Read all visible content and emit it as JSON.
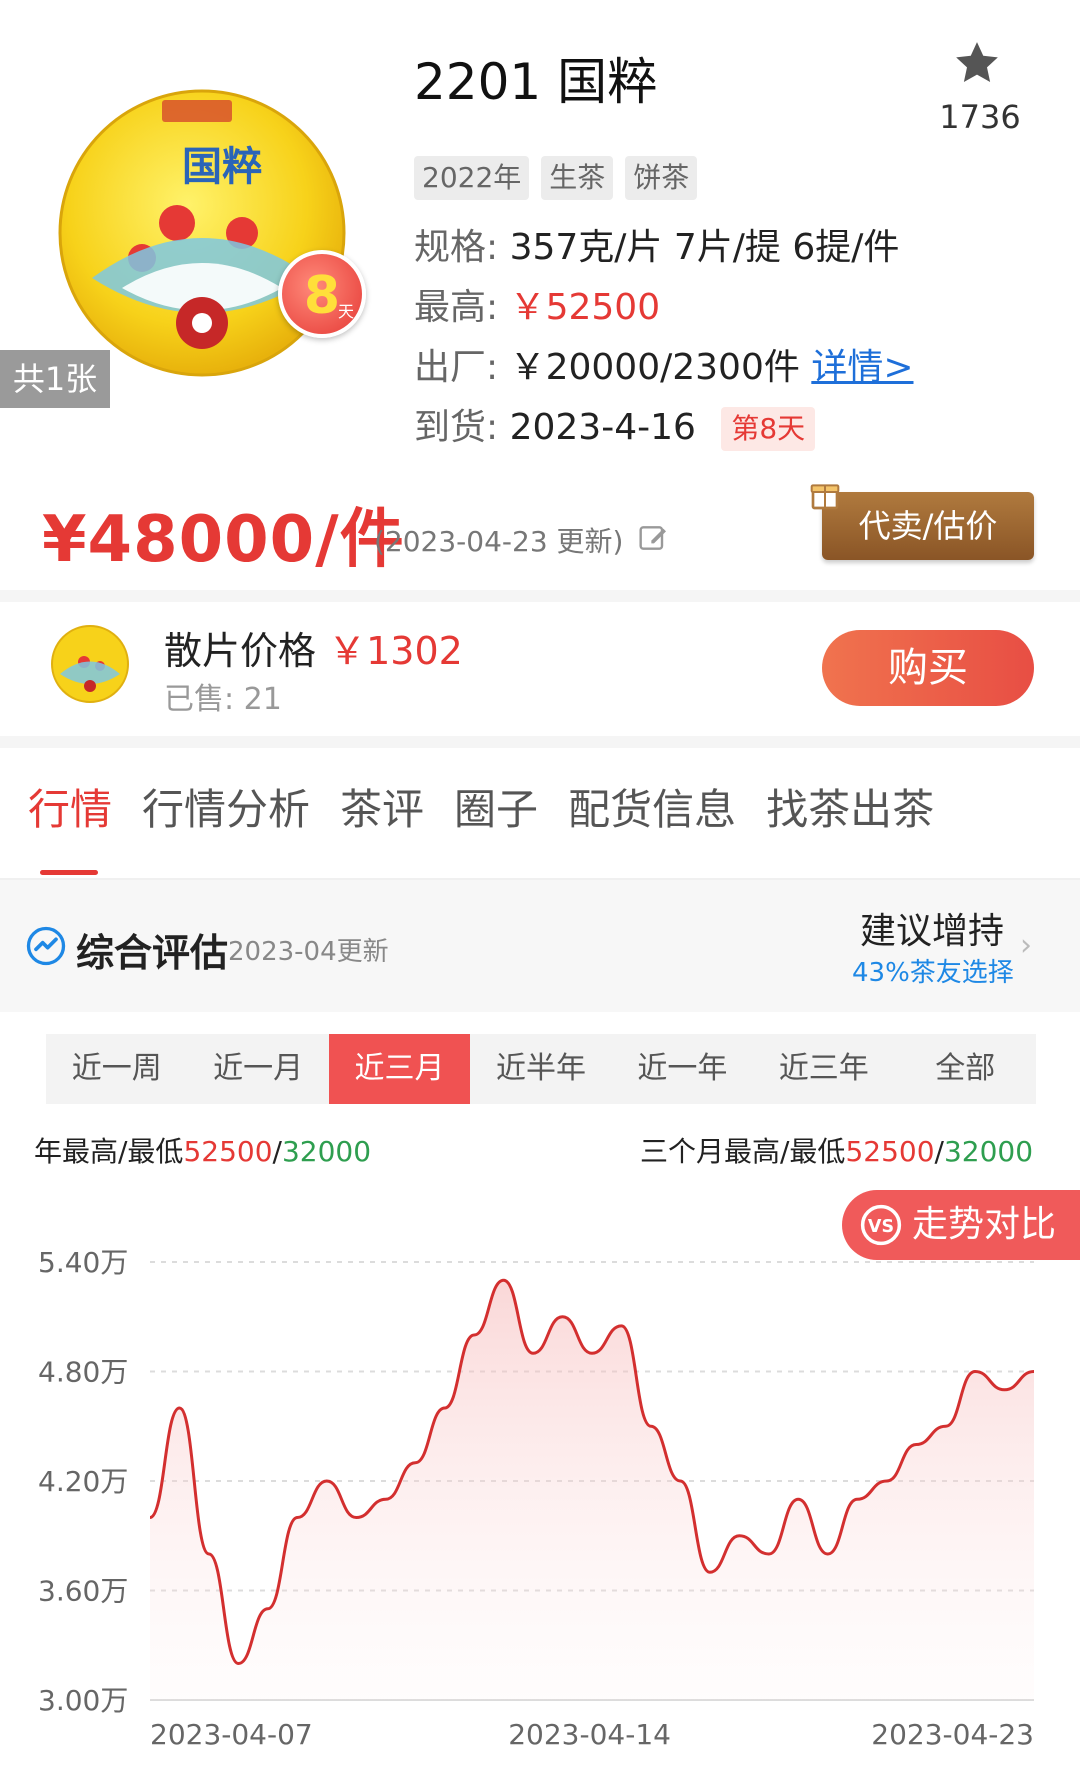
{
  "product": {
    "title": "2201 国粹",
    "favorite_count": "1736",
    "image_count": "共1张",
    "day_badge": "8",
    "day_badge_unit": "天",
    "tags": [
      "2022年",
      "生茶",
      "饼茶"
    ],
    "spec_label": "规格:",
    "spec_value": "357克/片 7片/提 6提/件",
    "high_label": "最高:",
    "high_value": "￥52500",
    "factory_label": "出厂:",
    "factory_value": "￥20000/2300件",
    "detail_link": "详情>",
    "arrival_label": "到货:",
    "arrival_value": "2023-4-16",
    "arrival_flag": "第8天"
  },
  "price": {
    "main": "¥48000/件",
    "update_note": "(2023-04-23 更新)",
    "sell_button": "代卖/估价"
  },
  "bulk": {
    "label": "散片价格",
    "price": "￥1302",
    "sold": "已售: 21",
    "buy_button": "购买"
  },
  "tabs": [
    "行情",
    "行情分析",
    "茶评",
    "圈子",
    "配货信息",
    "找茶出茶"
  ],
  "evaluation": {
    "title": "综合评估",
    "date": "2023-04更新",
    "advice": "建议增持",
    "percent": "43%茶友选择"
  },
  "periods": [
    "近一周",
    "近一月",
    "近三月",
    "近半年",
    "近一年",
    "近三年",
    "全部"
  ],
  "active_period": "近三月",
  "ranges": {
    "year_label": "年最高/最低",
    "year_high": "52500",
    "year_low": "32000",
    "three_month_label": "三个月最高/最低",
    "three_month_high": "52500",
    "three_month_low": "32000",
    "separator": "/"
  },
  "compare_button": "走势对比",
  "colors": {
    "accent_red": "#e53935",
    "low_green": "#2e9e4f",
    "link_blue": "#1e6fd9",
    "line": "#d32f2f"
  },
  "chart_data": {
    "type": "line",
    "ylim": [
      30000,
      54000
    ],
    "y_ticks": [
      "5.40万",
      "4.80万",
      "4.20万",
      "3.60万",
      "3.00万"
    ],
    "y_tick_values": [
      54000,
      48000,
      42000,
      36000,
      30000
    ],
    "x_tick_labels": [
      "2023-04-07",
      "2023-04-14",
      "2023-04-23"
    ],
    "x_tick_index": [
      0,
      0.4,
      1
    ],
    "series": [
      {
        "values": [
          40000,
          46000,
          38000,
          32000,
          35000,
          40000,
          42000,
          40000,
          41000,
          43000,
          46000,
          50000,
          53000,
          49000,
          51000,
          49000,
          50500,
          45000,
          42000,
          37000,
          39000,
          38000,
          41000,
          38000,
          41000,
          42000,
          44000,
          45000,
          48000,
          47000,
          48000
        ]
      }
    ]
  }
}
